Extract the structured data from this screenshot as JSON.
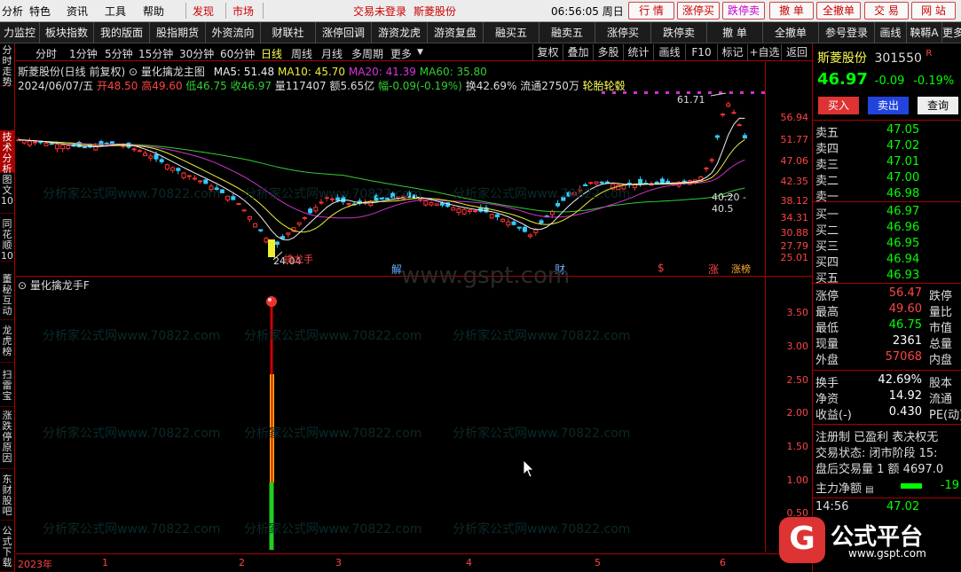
{
  "menubar": {
    "items": [
      "分析",
      "特色",
      "资讯",
      "工具",
      "帮助",
      "发现",
      "市场"
    ],
    "status": "交易未登录",
    "stock": "斯菱股份",
    "time": "06:56:05 周日",
    "buttons": [
      "行 情",
      "涨停买",
      "跌停卖",
      "撤 单",
      "全撤单",
      "交 易",
      "网 站"
    ]
  },
  "toolbar2": [
    "力监控",
    "板块指数",
    "我的版面",
    "股指期货",
    "外资流向",
    "财联社",
    "涨停回调",
    "游资龙虎",
    "游资复盘",
    "融买五",
    "融卖五",
    "涨停买",
    "跌停卖",
    "撤 单",
    "全撤单",
    "参号登录",
    "画线",
    "鞅鞯A",
    "更多"
  ],
  "sidebar": [
    "分时走势",
    "技术分析",
    "图文10",
    "同花顺10",
    "董秘互动",
    "龙虎榜",
    "扫雷宝",
    "涨跌停原因",
    "东财股吧",
    "公式下载"
  ],
  "periodbar": {
    "periods": [
      "分时",
      "1分钟",
      "5分钟",
      "15分钟",
      "30分钟",
      "60分钟",
      "日线",
      "周线",
      "月线",
      "多周期",
      "更多"
    ],
    "tools": [
      "复权",
      "叠加",
      "多股",
      "统计",
      "画线",
      "F10",
      "标记",
      "+自选",
      "返回"
    ]
  },
  "chart_header": {
    "name": "斯菱股份(日线 前复权)",
    "formula": "量化擒龙主图",
    "ma5": "MA5: 51.48",
    "ma10": "MA10: 45.70",
    "ma20": "MA20: 41.39",
    "ma60": "MA60: 35.80"
  },
  "chart_info": {
    "date": "2024/06/07/五",
    "open": "开48.50",
    "high": "高49.60",
    "low": "低46.75",
    "close": "收46.97",
    "vol": "量117407",
    "amount": "额5.65亿",
    "change": "幅-0.09(-0.19%)",
    "turnover": "换42.69%",
    "float": "流通2750万",
    "concept": "轮胎轮毂"
  },
  "price_axis": [
    "56.94",
    "51.77",
    "47.06",
    "42.35",
    "38.12",
    "34.31",
    "30.88",
    "27.79",
    "25.01"
  ],
  "annotations": {
    "high": "61.71",
    "low": "24.04",
    "level": "40.20 - 40.5",
    "markers": [
      "解",
      "财",
      "$",
      "涨",
      "涨榜"
    ],
    "buy_signal": "擒龙手"
  },
  "indicator": {
    "title": "量化擒龙手F",
    "axis": [
      "3.50",
      "3.00",
      "2.50",
      "2.00",
      "1.50",
      "1.00",
      "0.50"
    ]
  },
  "xaxis": [
    "2023年",
    "1",
    "2",
    "3",
    "4",
    "5",
    "6"
  ],
  "watermark": {
    "text": "分析家公式网www.70822.com",
    "center": "www.gspt.com",
    "logo_text": "公式平台",
    "logo_url": "www.gspt.com"
  },
  "right_panel": {
    "name": "斯菱股份",
    "code": "301550",
    "flag": "R",
    "price": "46.97",
    "change": "-0.09",
    "pct": "-0.19%",
    "btn_buy": "买入",
    "btn_sell": "卖出",
    "btn_query": "查询",
    "asks": [
      {
        "l": "卖五",
        "p": "47.05"
      },
      {
        "l": "卖四",
        "p": "47.02"
      },
      {
        "l": "卖三",
        "p": "47.01"
      },
      {
        "l": "卖二",
        "p": "47.00"
      },
      {
        "l": "卖一",
        "p": "46.98"
      }
    ],
    "bids": [
      {
        "l": "买一",
        "p": "46.97"
      },
      {
        "l": "买二",
        "p": "46.96"
      },
      {
        "l": "买三",
        "p": "46.95"
      },
      {
        "l": "买四",
        "p": "46.94"
      },
      {
        "l": "买五",
        "p": "46.93"
      }
    ],
    "stats": [
      {
        "l": "涨停",
        "v": "56.47",
        "r": "跌停"
      },
      {
        "l": "最高",
        "v": "49.60",
        "r": "量比"
      },
      {
        "l": "最低",
        "v": "46.75",
        "r": "市值"
      },
      {
        "l": "现量",
        "v": "2361",
        "r": "总量"
      },
      {
        "l": "外盘",
        "v": "57068",
        "r": "内盘"
      }
    ],
    "stats2": [
      {
        "l": "换手",
        "v": "42.69%",
        "r": "股本"
      },
      {
        "l": "净资",
        "v": "14.92",
        "r": "流通"
      },
      {
        "l": "收益(-)",
        "v": "0.430",
        "r": "PE(动)"
      }
    ],
    "reg": "注册制 已盈利 表决权无",
    "status": "交易状态: 闭市阶段 15:",
    "after": "盘后交易量 1 额 4697.0",
    "net_label": "主力净额",
    "net_val": "-19",
    "tick_time": "14:56",
    "tick_price": "47.02"
  }
}
